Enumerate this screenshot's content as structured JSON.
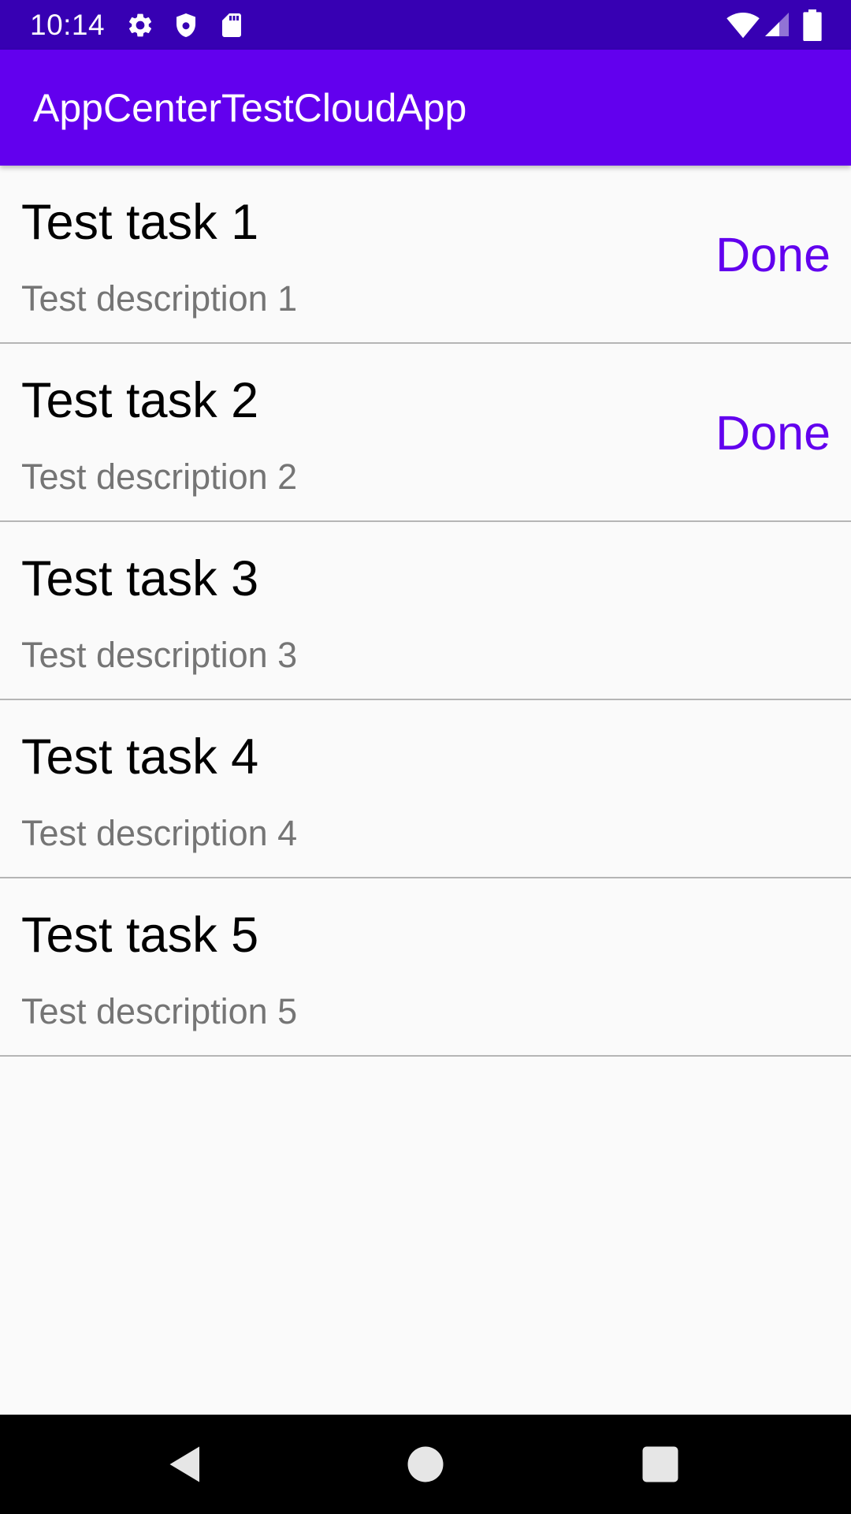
{
  "status_bar": {
    "time": "10:14",
    "background": "#3700b3",
    "icons_left": [
      "settings-icon",
      "shield-icon",
      "sd-card-icon"
    ],
    "icons_right": [
      "wifi-icon",
      "signal-icon",
      "battery-icon"
    ]
  },
  "app_bar": {
    "title": "AppCenterTestCloudApp",
    "background": "#6200ee"
  },
  "tasks": [
    {
      "title": "Test task 1",
      "description": "Test description 1",
      "action_label": "Done"
    },
    {
      "title": "Test task 2",
      "description": "Test description 2",
      "action_label": "Done"
    },
    {
      "title": "Test task 3",
      "description": "Test description 3",
      "action_label": ""
    },
    {
      "title": "Test task 4",
      "description": "Test description 4",
      "action_label": ""
    },
    {
      "title": "Test task 5",
      "description": "Test description 5",
      "action_label": ""
    }
  ],
  "colors": {
    "accent": "#6200ee",
    "title_text": "#000000",
    "description_text": "#757575",
    "divider": "#b5b5b5",
    "background": "#fafafa"
  },
  "nav_bar": {
    "buttons": [
      "back-icon",
      "home-icon",
      "recents-icon"
    ]
  }
}
